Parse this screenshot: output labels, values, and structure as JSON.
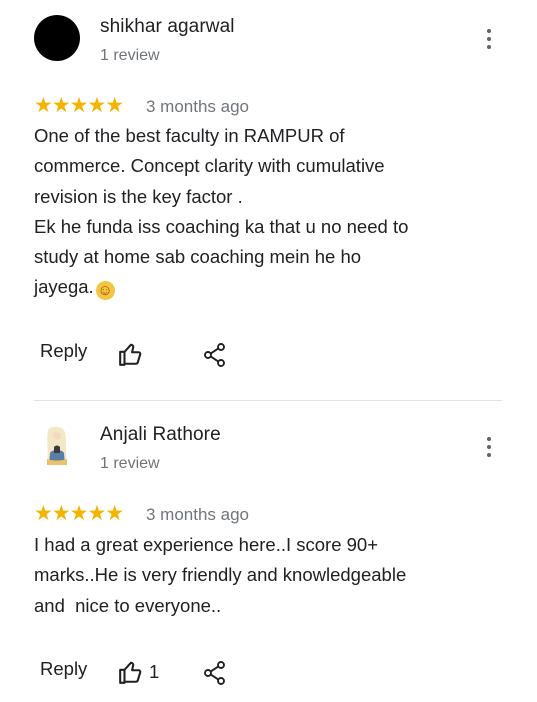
{
  "reviews": [
    {
      "author": "shikhar agarwal",
      "review_count": "1 review",
      "rating": 5,
      "stars": "★★★★★",
      "time_ago": "3 months ago",
      "text": "One of the best faculty in RAMPUR of\ncommerce. Concept clarity with cumulative\nrevision is the key factor .\nEk he funda iss coaching ka that u no need to\nstudy at home sab coaching mein he ho\njayega.",
      "emoji": "☺",
      "reply_label": "Reply",
      "like_count": "",
      "avatar_color": "#000000"
    },
    {
      "author": "Anjali Rathore",
      "review_count": "1 review",
      "rating": 5,
      "stars": "★★★★★",
      "time_ago": "3 months ago",
      "text": "I had a great experience here..I score 90+\nmarks..He is very friendly and knowledgeable\nand  nice to everyone..",
      "reply_label": "Reply",
      "like_count": "1",
      "avatar_color": "#ffffff"
    }
  ],
  "colors": {
    "star": "#f4b400",
    "secondary_text": "#70757a",
    "icon": "#202124",
    "divider": "#e3e3e3"
  },
  "icons": [
    "more-vert-icon",
    "thumb-up-icon",
    "share-icon"
  ]
}
